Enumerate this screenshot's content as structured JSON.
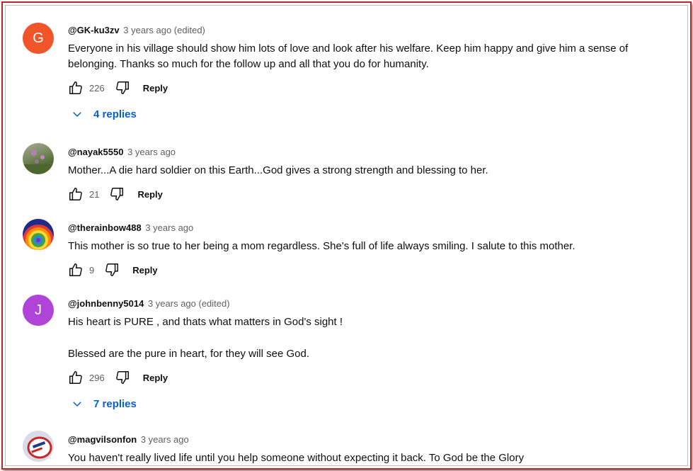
{
  "comments": [
    {
      "avatar_letter": "G",
      "avatar_color": "#f0552a",
      "handle": "@GK-ku3zv",
      "time": "3 years ago (edited)",
      "paragraphs": [
        "Everyone in his village should show him lots of love and look after his welfare. Keep him happy and give him a sense of belonging. Thanks so much for the follow up and all that you do for humanity."
      ],
      "likes": "226",
      "reply_label": "Reply",
      "replies_label": "4 replies"
    },
    {
      "avatar_letter": "",
      "avatar_color": "#6b7a4d",
      "handle": "@nayak5550",
      "time": "3 years ago",
      "paragraphs": [
        "Mother...A die hard soldier on this Earth...God gives a strong strength and blessing to her."
      ],
      "likes": "21",
      "reply_label": "Reply"
    },
    {
      "avatar_letter": "",
      "avatar_color": "#2b4bd6",
      "handle": "@therainbow488",
      "time": "3 years ago",
      "paragraphs": [
        "This mother is so true to her being a mom regardless. She's full of life always smiling. I salute to this mother."
      ],
      "likes": "9",
      "reply_label": "Reply"
    },
    {
      "avatar_letter": "J",
      "avatar_color": "#b044d8",
      "handle": "@johnbenny5014",
      "time": "3 years ago (edited)",
      "paragraphs": [
        "His heart is PURE , and thats what matters in God's sight !",
        "Blessed are the pure in heart, for they will see God."
      ],
      "likes": "296",
      "reply_label": "Reply",
      "replies_label": "7 replies"
    },
    {
      "avatar_letter": "",
      "avatar_color": "#e8e8ee",
      "handle": "@magvilsonfon",
      "time": "3 years ago",
      "paragraphs": [
        "You haven't really lived life until you help someone without expecting it back. To God be the Glory"
      ]
    }
  ],
  "icons": {
    "like": "thumb-up-icon",
    "dislike": "thumb-down-icon",
    "expand": "chevron-down-icon"
  },
  "colors": {
    "link_blue": "#065fd4",
    "frame_red": "#b22a2a",
    "meta_gray": "#606060"
  }
}
